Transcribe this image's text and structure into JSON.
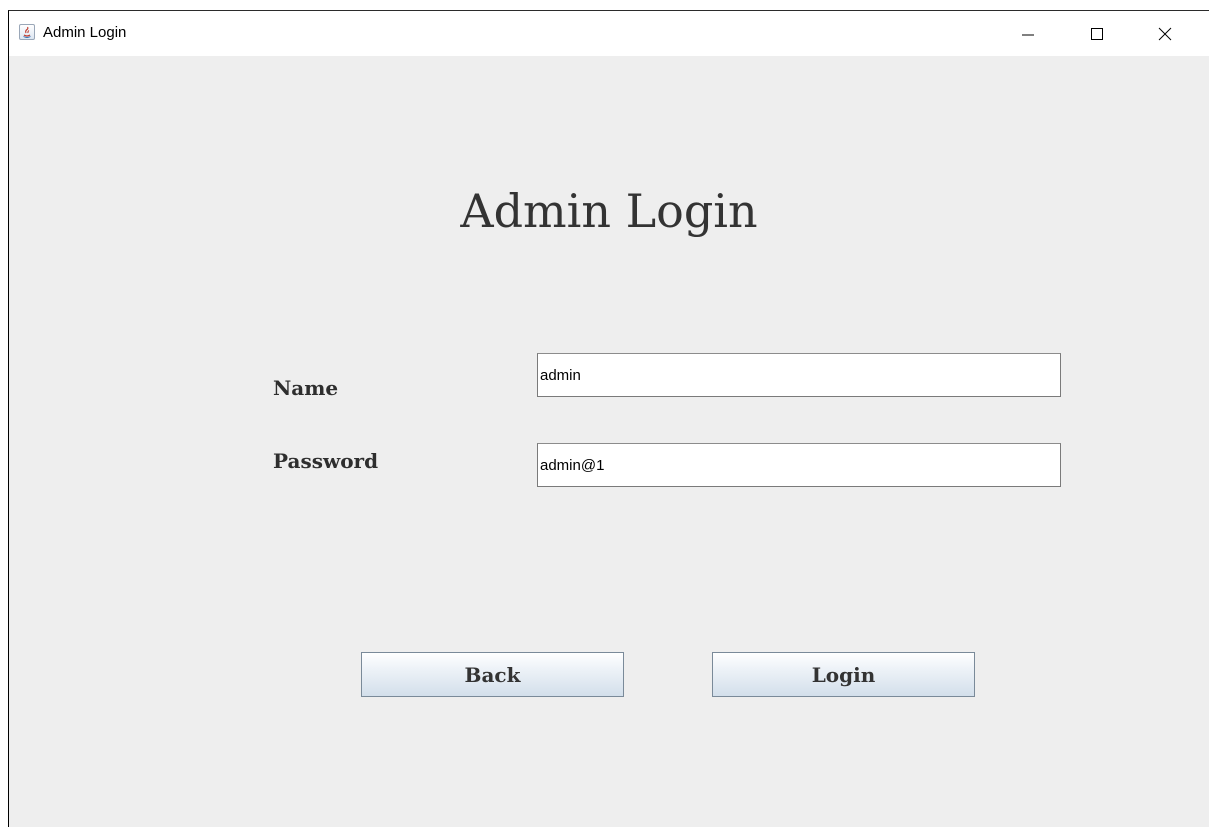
{
  "window": {
    "title": "Admin Login",
    "icon": "java-app-icon",
    "controls": {
      "minimize": "minimize-icon",
      "maximize": "maximize-icon",
      "close": "close-icon"
    }
  },
  "form": {
    "heading": "Admin Login",
    "name_label": "Name",
    "name_value": "admin",
    "password_label": "Password",
    "password_value": "admin@1"
  },
  "buttons": {
    "back": "Back",
    "login": "Login"
  },
  "colors": {
    "background": "#eeeeee",
    "titlebar": "#ffffff",
    "text": "#333333",
    "accent": "#3a8ee6"
  }
}
